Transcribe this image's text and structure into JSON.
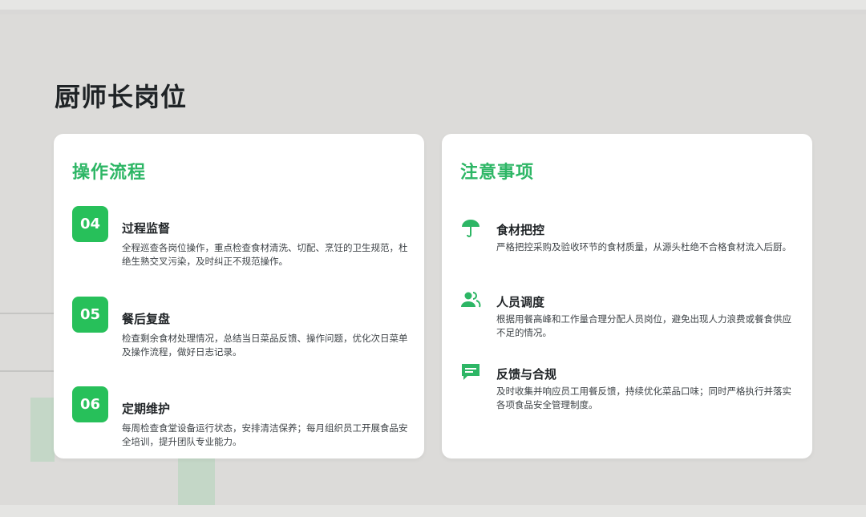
{
  "page": {
    "title": "厨师长岗位"
  },
  "left_card": {
    "title": "操作流程",
    "steps": [
      {
        "number": "04",
        "title": "过程监督",
        "desc": "全程巡查各岗位操作，重点检查食材清洗、切配、烹饪的卫生规范，杜绝生熟交叉污染，及时纠正不规范操作。"
      },
      {
        "number": "05",
        "title": "餐后复盘",
        "desc": "检查剩余食材处理情况，总结当日菜品反馈、操作问题，优化次日菜单及操作流程，做好日志记录。"
      },
      {
        "number": "06",
        "title": "定期维护",
        "desc": "每周检查食堂设备运行状态，安排清洁保养；每月组织员工开展食品安全培训，提升团队专业能力。"
      }
    ]
  },
  "right_card": {
    "title": "注意事项",
    "items": [
      {
        "icon": "umbrella-icon",
        "title": "食材把控",
        "desc": "严格把控采购及验收环节的食材质量，从源头杜绝不合格食材流入后厨。"
      },
      {
        "icon": "people-icon",
        "title": "人员调度",
        "desc": "根据用餐高峰和工作量合理分配人员岗位，避免出现人力浪费或餐食供应不足的情况。"
      },
      {
        "icon": "chat-bubble-icon",
        "title": "反馈与合规",
        "desc": "及时收集并响应员工用餐反馈，持续优化菜品口味；同时严格执行并落实各项食品安全管理制度。"
      }
    ]
  },
  "colors": {
    "accent": "#27c05a",
    "heading_green": "#2db665",
    "text_dark": "#1f2326"
  }
}
